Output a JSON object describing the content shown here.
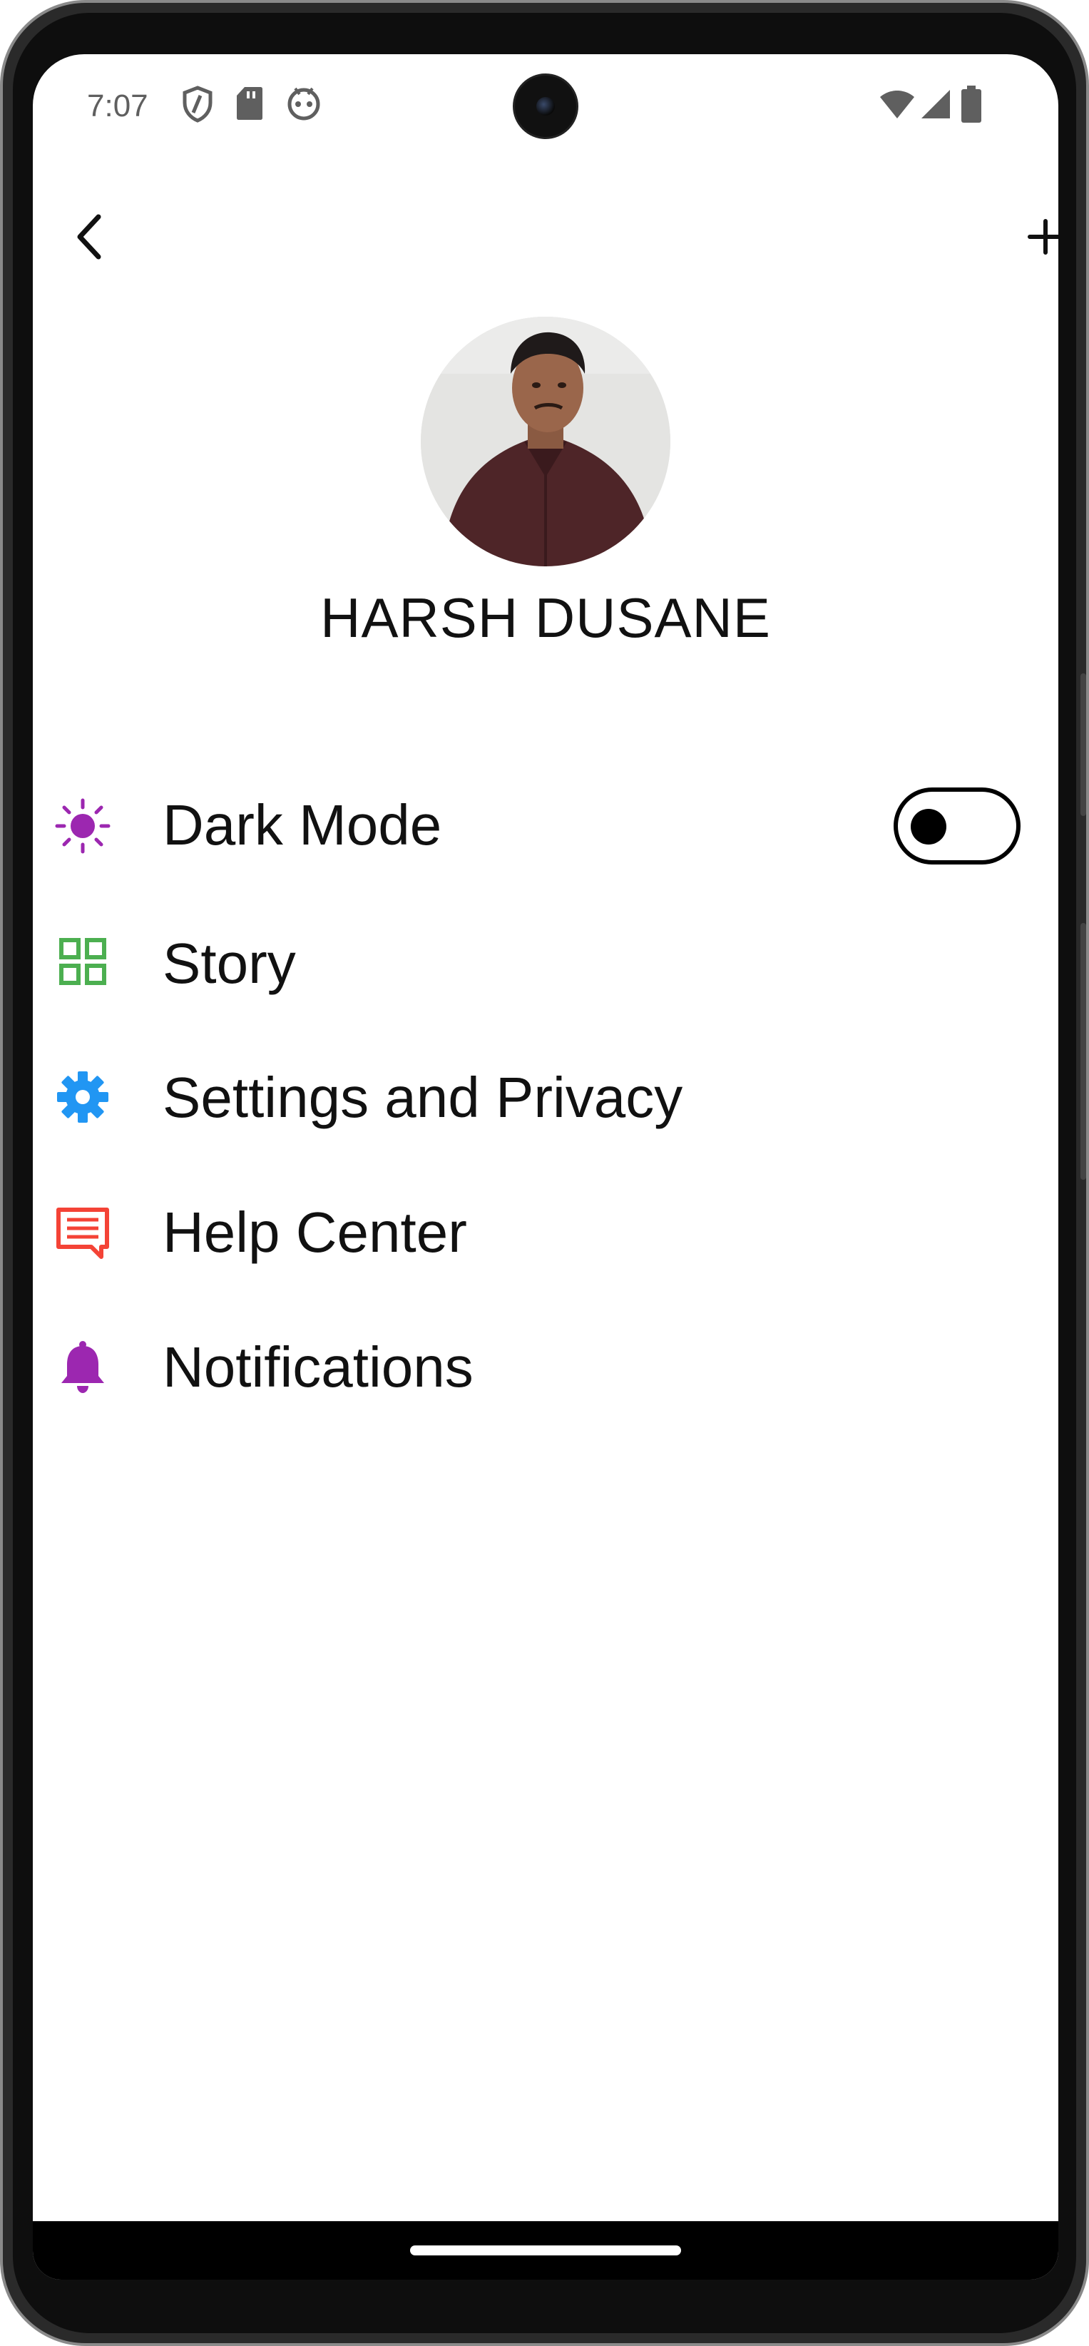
{
  "status_bar": {
    "time": "7:07",
    "left_icons": [
      "shield-icon",
      "sd-card-icon",
      "android-icon"
    ],
    "right_icons": [
      "wifi-icon",
      "signal-icon",
      "battery-icon"
    ]
  },
  "app_bar": {
    "back_icon": "chevron-left-icon",
    "add_icon": "plus-icon"
  },
  "profile": {
    "name": "HARSH DUSANE"
  },
  "menu": {
    "items": [
      {
        "label": "Dark Mode",
        "icon": "sun-icon",
        "color": "#9C27B0"
      },
      {
        "label": "Story",
        "icon": "grid-icon",
        "color": "#4CAF50"
      },
      {
        "label": "Settings and Privacy",
        "icon": "gear-icon",
        "color": "#2196F3"
      },
      {
        "label": "Help Center",
        "icon": "chat-icon",
        "color": "#F44336"
      },
      {
        "label": "Notifications",
        "icon": "bell-icon",
        "color": "#9C27B0"
      }
    ],
    "dark_mode_enabled": false
  }
}
